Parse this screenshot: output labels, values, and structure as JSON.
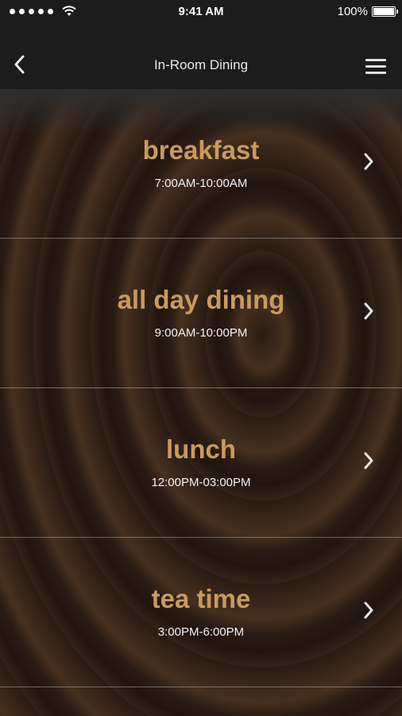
{
  "status_bar": {
    "time": "9:41 AM",
    "battery_text": "100%",
    "battery_level": 1.0,
    "signal_icon": "signal-dots-icon",
    "wifi_icon": "wifi-icon"
  },
  "nav": {
    "title": "In-Room Dining",
    "back_icon": "chevron-left-icon",
    "menu_icon": "hamburger-menu-icon"
  },
  "menus": [
    {
      "name": "breakfast",
      "hours": "7:00AM-10:00AM"
    },
    {
      "name": "all day dining",
      "hours": "9:00AM-10:00PM"
    },
    {
      "name": "lunch",
      "hours": "12:00PM-03:00PM"
    },
    {
      "name": "tea time",
      "hours": "3:00PM-6:00PM"
    }
  ],
  "colors": {
    "accent": "#c99a5e",
    "bar_background": "#1c1c1c"
  }
}
